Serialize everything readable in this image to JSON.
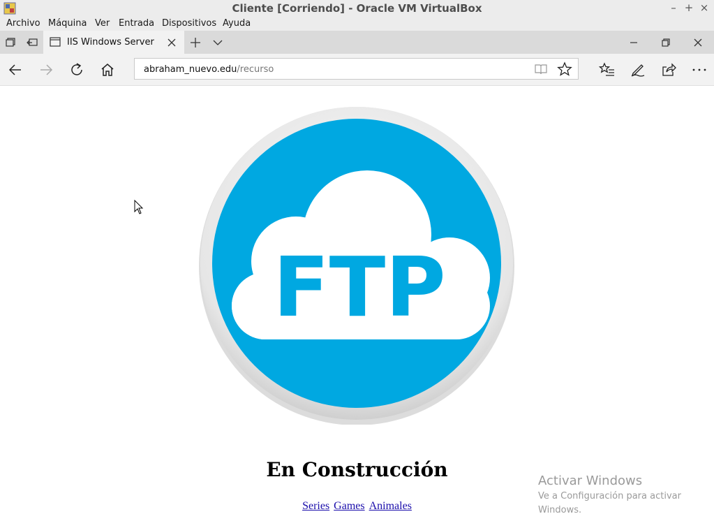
{
  "vbox": {
    "title": "Cliente [Corriendo] - Oracle VM VirtualBox",
    "menu": [
      "Archivo",
      "Máquina",
      "Ver",
      "Entrada",
      "Dispositivos",
      "Ayuda"
    ],
    "window_buttons": [
      "minimize-icon",
      "maximize-icon",
      "close-icon"
    ]
  },
  "browser": {
    "tab_title": "IIS Windows Server",
    "address_host": "abraham_nuevo.edu",
    "address_path": "/recurso",
    "toolbar_icons": [
      "back-icon",
      "forward-icon",
      "refresh-icon",
      "home-icon",
      "reading-view-icon",
      "favorite-star-icon",
      "favorites-hub-icon",
      "pen-icon",
      "share-icon",
      "more-icon"
    ]
  },
  "page": {
    "logo_text": "FTP",
    "heading": "En Construcción",
    "links": [
      "Series",
      "Games",
      "Animales"
    ],
    "colors": {
      "logo_blue": "#00a8e1",
      "link": "#1a0dab"
    }
  },
  "watermark": {
    "title": "Activar Windows",
    "subtitle": "Ve a Configuración para activar Windows."
  }
}
